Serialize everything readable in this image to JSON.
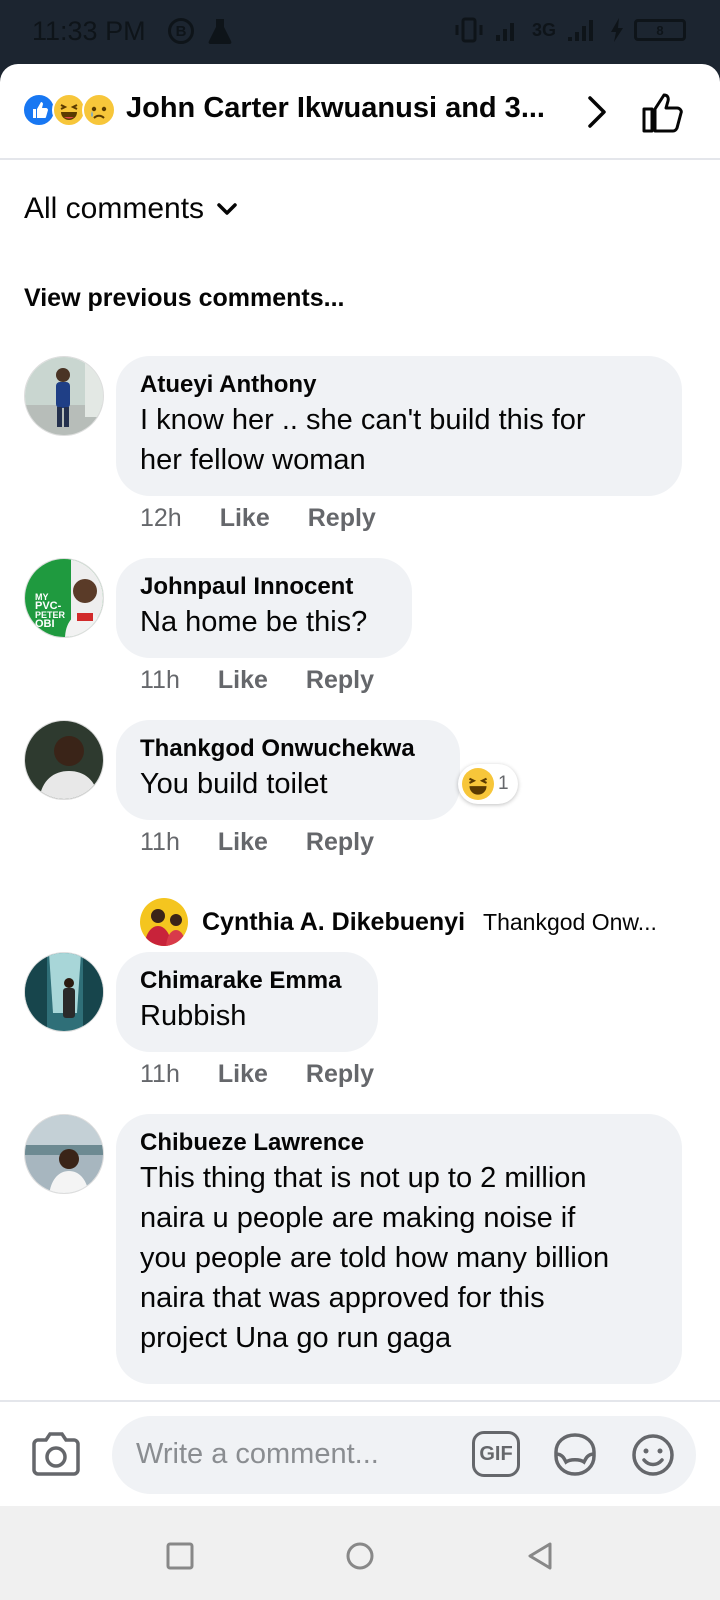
{
  "status_bar": {
    "time": "11:33 PM",
    "network": "3G",
    "battery": "8"
  },
  "header": {
    "title": "John Carter Ikwuanusi and 3...",
    "reaction_icons": [
      "like-icon",
      "haha-icon",
      "sad-icon"
    ]
  },
  "filter": {
    "label": "All comments"
  },
  "view_previous": "View previous comments...",
  "comments": [
    {
      "author": "Atueyi Anthony",
      "lines": [
        "I know her .. she can't build this for",
        "her fellow woman"
      ],
      "time": "12h",
      "like": "Like",
      "reply": "Reply"
    },
    {
      "author": "Johnpaul Innocent",
      "lines": [
        "Na home be this?"
      ],
      "time": "11h",
      "like": "Like",
      "reply": "Reply",
      "avatar_text": [
        "MY",
        "PVC-",
        "PETER",
        "OBI"
      ]
    },
    {
      "author": "Thankgod Onwuchekwa",
      "lines": [
        "You build toilet"
      ],
      "time": "11h",
      "like": "Like",
      "reply": "Reply",
      "reaction_count": "1"
    },
    {
      "author": "Chimarake Emma",
      "lines": [
        "Rubbish"
      ],
      "time": "11h",
      "like": "Like",
      "reply": "Reply"
    },
    {
      "author": "Chibueze Lawrence",
      "lines": [
        "This thing that is not up to 2 million",
        "naira u people are making noise if",
        "you people are told how many billion",
        "naira that was approved for this",
        "project Una go run gaga"
      ]
    }
  ],
  "reply_preview": {
    "author": "Cynthia A. Dikebuenyi",
    "text": "Thankgod Onw..."
  },
  "composer": {
    "placeholder": "Write a comment...",
    "gif_label": "GIF"
  },
  "colors": {
    "status_bar": "#1c2530",
    "bubble": "#f0f2f5",
    "meta_text": "#65676b",
    "like_blue": "#1877f2",
    "emoji_yellow": "#f7c63a"
  }
}
